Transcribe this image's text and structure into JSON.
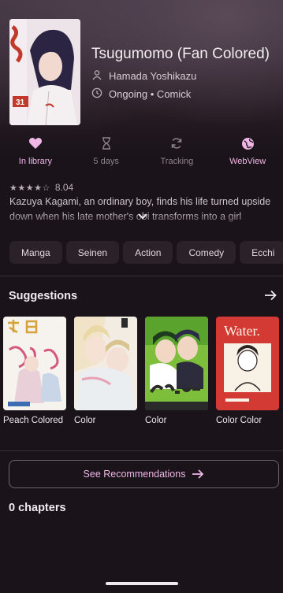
{
  "manga": {
    "title": "Tsugumomo (Fan Colored)",
    "author": "Hamada Yoshikazu",
    "status": "Ongoing • Comick",
    "cover_badge": "31"
  },
  "actions": [
    {
      "label": "In library",
      "icon": "heart-icon",
      "active": true
    },
    {
      "label": "5 days",
      "icon": "hourglass-icon",
      "active": false
    },
    {
      "label": "Tracking",
      "icon": "sync-icon",
      "active": false
    },
    {
      "label": "WebView",
      "icon": "globe-icon",
      "active": true
    }
  ],
  "rating": {
    "stars": "★★★★☆",
    "value": "8.04"
  },
  "description": {
    "line1": "Kazuya Kagami, an ordinary boy, finds his life turned upside",
    "line2": "down when his late mother's obi transforms into a girl"
  },
  "tags": [
    "Manga",
    "Seinen",
    "Action",
    "Comedy",
    "Ecchi"
  ],
  "suggestions": {
    "title": "Suggestions",
    "items": [
      {
        "label": "Peach Colored"
      },
      {
        "label": "Color"
      },
      {
        "label": "Color"
      },
      {
        "label": "Color Color",
        "cover_text": "Water."
      }
    ]
  },
  "see_recommendations": "See Recommendations",
  "chapters": "0 chapters",
  "colors": {
    "accent": "#efb6e6",
    "background": "#1a1319"
  }
}
